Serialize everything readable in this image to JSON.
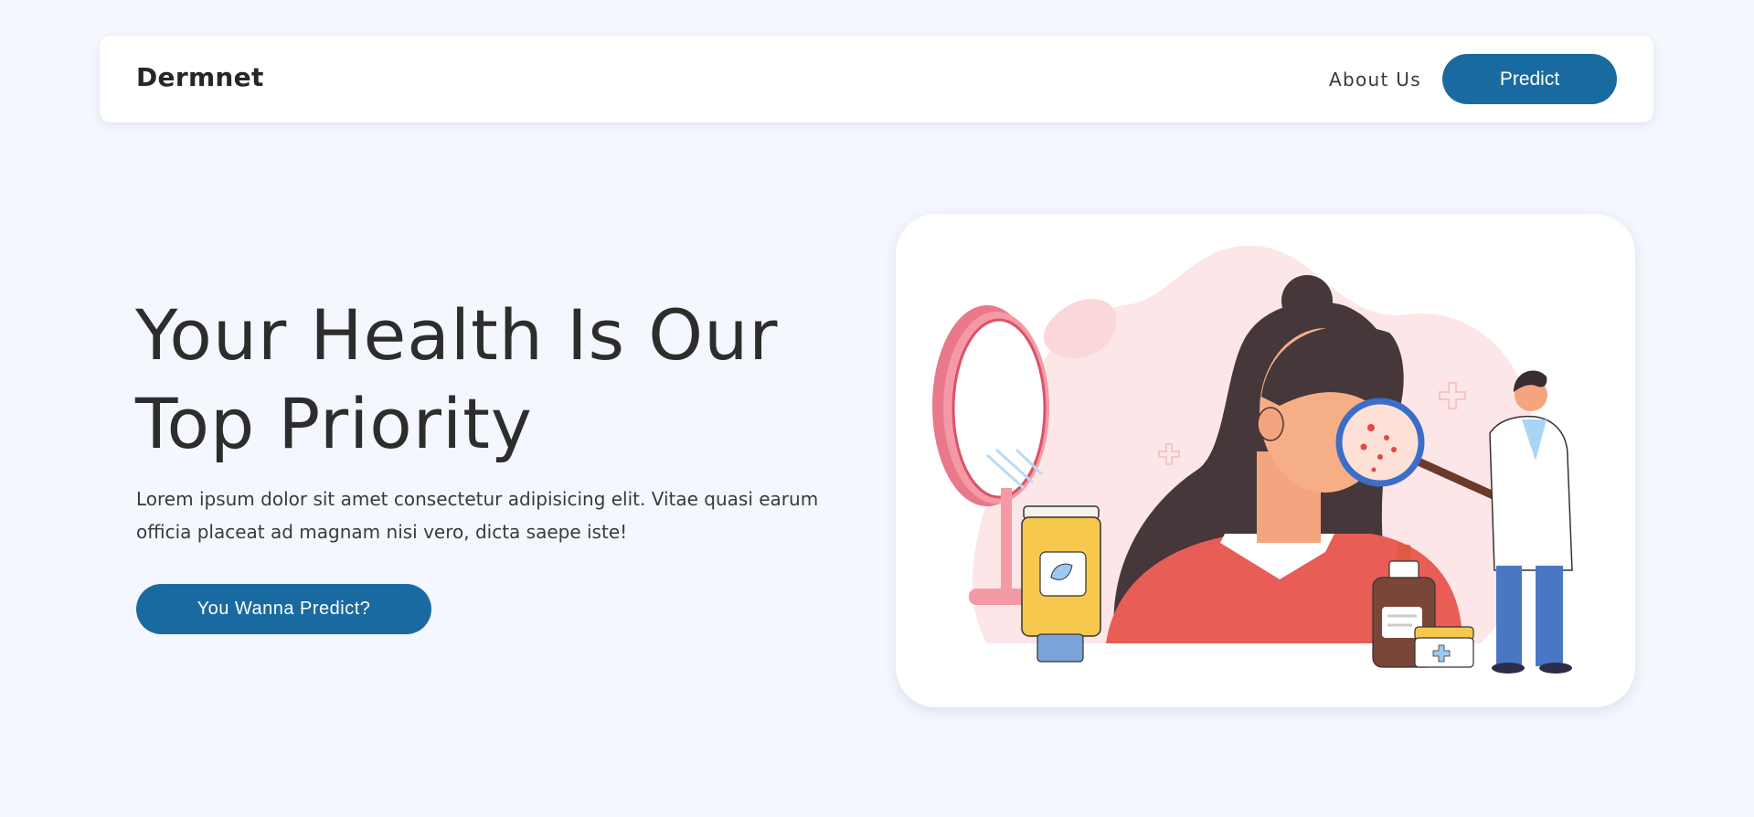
{
  "navbar": {
    "brand": "Dermnet",
    "about_label": "About Us",
    "predict_label": "Predict"
  },
  "hero": {
    "title_line1": "Your Health Is Our",
    "title_line2": "Top Priority",
    "description": "Lorem ipsum dolor sit amet consectetur adipisicing elit. Vitae quasi earum officia placeat ad magnam nisi vero, dicta saepe iste!",
    "cta_label": "You Wanna Predict?"
  },
  "illustration": {
    "subject": "dermatologist-examining-skin-illustration"
  },
  "colors": {
    "primary": "#1a6aa2",
    "background": "#f4f7fd",
    "card": "#ffffff"
  }
}
